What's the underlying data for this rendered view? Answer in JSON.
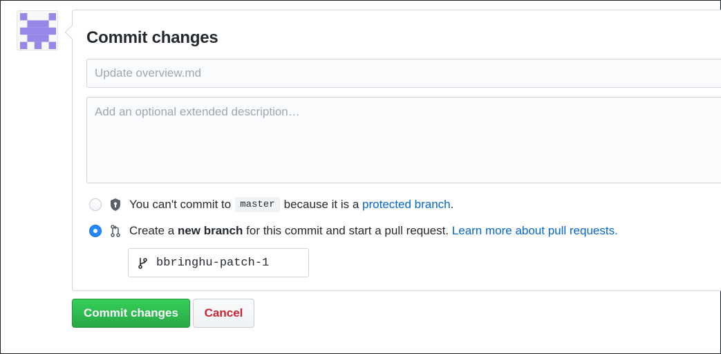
{
  "avatar": {
    "icon": "identicon-icon",
    "color": "#9887e8"
  },
  "form": {
    "title": "Commit changes",
    "summary_placeholder": "Update overview.md",
    "summary_value": "",
    "description_placeholder": "Add an optional extended description…",
    "description_value": ""
  },
  "options": {
    "direct_commit": {
      "selected": false,
      "icon": "lock-shield-icon",
      "text_before": "You can't commit to",
      "branch": "master",
      "text_after": "because it is a",
      "link": "protected branch",
      "suffix": "."
    },
    "new_branch": {
      "selected": true,
      "icon": "pull-request-icon",
      "text_before": "Create a",
      "bold": "new branch",
      "text_after": "for this commit and start a pull request.",
      "link": "Learn more about pull requests."
    }
  },
  "branch_input": {
    "icon": "branch-icon",
    "value": "bbringhu-patch-1"
  },
  "buttons": {
    "commit": "Commit changes",
    "cancel": "Cancel"
  },
  "colors": {
    "primary_green": "#28a745",
    "link_blue": "#0366d6",
    "danger_red": "#cb2431",
    "radio_blue": "#2188ff"
  }
}
